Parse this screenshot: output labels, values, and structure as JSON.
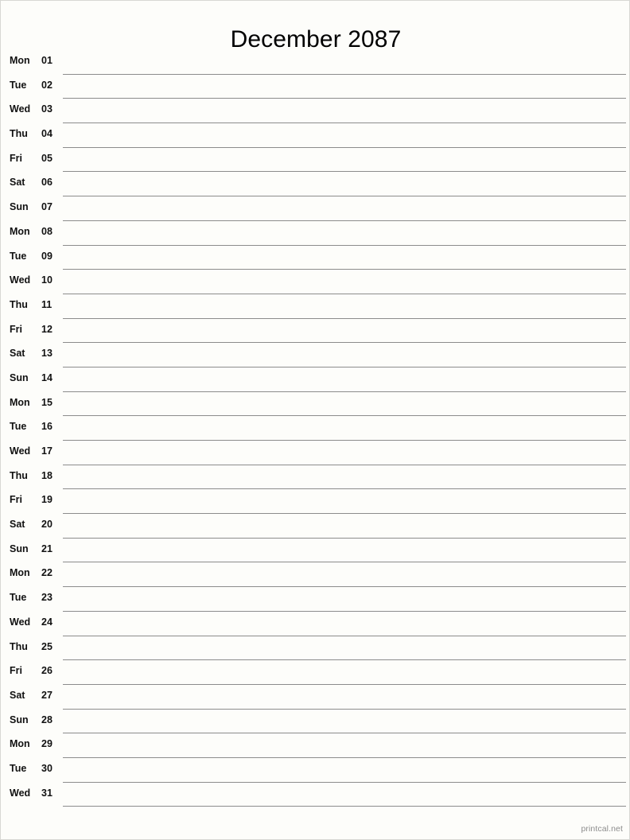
{
  "page": {
    "title": "December 2087",
    "month_name": "December",
    "year": "2087",
    "background_color": "#fdfdfa",
    "line_color": "#8c8c8c",
    "text_color": "#111111"
  },
  "footer": {
    "credit": "printcal.net"
  },
  "chart_data": {
    "type": "table",
    "title": "December 2087",
    "columns": [
      "weekday",
      "day"
    ],
    "rows": [
      {
        "weekday": "Mon",
        "day": "01"
      },
      {
        "weekday": "Tue",
        "day": "02"
      },
      {
        "weekday": "Wed",
        "day": "03"
      },
      {
        "weekday": "Thu",
        "day": "04"
      },
      {
        "weekday": "Fri",
        "day": "05"
      },
      {
        "weekday": "Sat",
        "day": "06"
      },
      {
        "weekday": "Sun",
        "day": "07"
      },
      {
        "weekday": "Mon",
        "day": "08"
      },
      {
        "weekday": "Tue",
        "day": "09"
      },
      {
        "weekday": "Wed",
        "day": "10"
      },
      {
        "weekday": "Thu",
        "day": "11"
      },
      {
        "weekday": "Fri",
        "day": "12"
      },
      {
        "weekday": "Sat",
        "day": "13"
      },
      {
        "weekday": "Sun",
        "day": "14"
      },
      {
        "weekday": "Mon",
        "day": "15"
      },
      {
        "weekday": "Tue",
        "day": "16"
      },
      {
        "weekday": "Wed",
        "day": "17"
      },
      {
        "weekday": "Thu",
        "day": "18"
      },
      {
        "weekday": "Fri",
        "day": "19"
      },
      {
        "weekday": "Sat",
        "day": "20"
      },
      {
        "weekday": "Sun",
        "day": "21"
      },
      {
        "weekday": "Mon",
        "day": "22"
      },
      {
        "weekday": "Tue",
        "day": "23"
      },
      {
        "weekday": "Wed",
        "day": "24"
      },
      {
        "weekday": "Thu",
        "day": "25"
      },
      {
        "weekday": "Fri",
        "day": "26"
      },
      {
        "weekday": "Sat",
        "day": "27"
      },
      {
        "weekday": "Sun",
        "day": "28"
      },
      {
        "weekday": "Mon",
        "day": "29"
      },
      {
        "weekday": "Tue",
        "day": "30"
      },
      {
        "weekday": "Wed",
        "day": "31"
      }
    ]
  },
  "days": [
    {
      "weekday": "Mon",
      "day": "01"
    },
    {
      "weekday": "Tue",
      "day": "02"
    },
    {
      "weekday": "Wed",
      "day": "03"
    },
    {
      "weekday": "Thu",
      "day": "04"
    },
    {
      "weekday": "Fri",
      "day": "05"
    },
    {
      "weekday": "Sat",
      "day": "06"
    },
    {
      "weekday": "Sun",
      "day": "07"
    },
    {
      "weekday": "Mon",
      "day": "08"
    },
    {
      "weekday": "Tue",
      "day": "09"
    },
    {
      "weekday": "Wed",
      "day": "10"
    },
    {
      "weekday": "Thu",
      "day": "11"
    },
    {
      "weekday": "Fri",
      "day": "12"
    },
    {
      "weekday": "Sat",
      "day": "13"
    },
    {
      "weekday": "Sun",
      "day": "14"
    },
    {
      "weekday": "Mon",
      "day": "15"
    },
    {
      "weekday": "Tue",
      "day": "16"
    },
    {
      "weekday": "Wed",
      "day": "17"
    },
    {
      "weekday": "Thu",
      "day": "18"
    },
    {
      "weekday": "Fri",
      "day": "19"
    },
    {
      "weekday": "Sat",
      "day": "20"
    },
    {
      "weekday": "Sun",
      "day": "21"
    },
    {
      "weekday": "Mon",
      "day": "22"
    },
    {
      "weekday": "Tue",
      "day": "23"
    },
    {
      "weekday": "Wed",
      "day": "24"
    },
    {
      "weekday": "Thu",
      "day": "25"
    },
    {
      "weekday": "Fri",
      "day": "26"
    },
    {
      "weekday": "Sat",
      "day": "27"
    },
    {
      "weekday": "Sun",
      "day": "28"
    },
    {
      "weekday": "Mon",
      "day": "29"
    },
    {
      "weekday": "Tue",
      "day": "30"
    },
    {
      "weekday": "Wed",
      "day": "31"
    }
  ]
}
